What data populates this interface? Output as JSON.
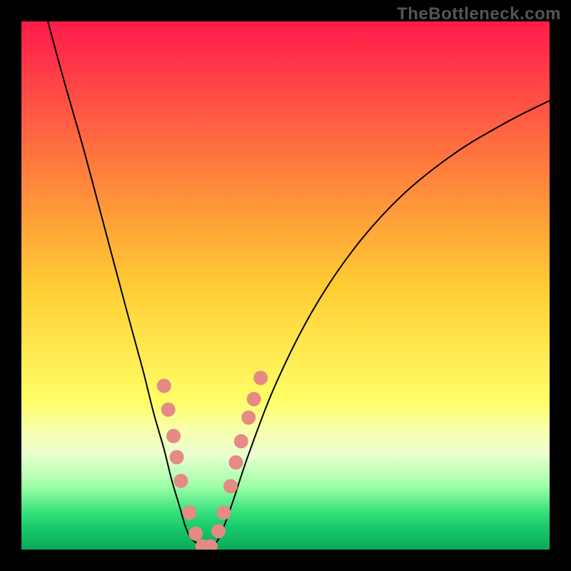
{
  "watermark": "TheBottleneck.com",
  "chart_data": {
    "type": "line",
    "title": "",
    "xlabel": "",
    "ylabel": "",
    "xlim": [
      0,
      100
    ],
    "ylim": [
      0,
      100
    ],
    "grid": false,
    "legend": false,
    "annotations": [],
    "background": {
      "type": "vertical-gradient",
      "stops": [
        {
          "offset": 0.0,
          "color": "#ff1a4b"
        },
        {
          "offset": 0.5,
          "color": "#ffcc33"
        },
        {
          "offset": 0.72,
          "color": "#ffff66"
        },
        {
          "offset": 0.78,
          "color": "#f6ffb3"
        },
        {
          "offset": 0.82,
          "color": "#eaffd0"
        },
        {
          "offset": 0.88,
          "color": "#9effa8"
        },
        {
          "offset": 0.93,
          "color": "#34e07a"
        },
        {
          "offset": 0.96,
          "color": "#17c86a"
        },
        {
          "offset": 1.0,
          "color": "#0aa85a"
        }
      ]
    },
    "series": [
      {
        "name": "curve",
        "color": "#000000",
        "width": 2,
        "x": [
          5,
          8,
          12,
          16,
          20,
          23,
          25,
          27,
          28.5,
          30,
          31,
          32,
          33.5,
          35,
          36,
          37,
          38,
          40,
          43,
          48,
          55,
          63,
          72,
          82,
          92,
          100
        ],
        "y": [
          100,
          89,
          75,
          60,
          45,
          34,
          26,
          19,
          13,
          8,
          4.5,
          2.3,
          1.0,
          0.4,
          0.4,
          1.5,
          3.5,
          9,
          18,
          31,
          45,
          57,
          67,
          75,
          81,
          85
        ]
      }
    ],
    "markers": [
      {
        "name": "dots",
        "color": "#e58a84",
        "radius": 10,
        "points": [
          {
            "x": 27.0,
            "y": 31.0
          },
          {
            "x": 27.8,
            "y": 26.5
          },
          {
            "x": 28.8,
            "y": 21.5
          },
          {
            "x": 29.4,
            "y": 17.5
          },
          {
            "x": 30.2,
            "y": 13.0
          },
          {
            "x": 31.8,
            "y": 7.0
          },
          {
            "x": 33.0,
            "y": 3.0
          },
          {
            "x": 34.3,
            "y": 0.6
          },
          {
            "x": 35.8,
            "y": 0.6
          },
          {
            "x": 37.3,
            "y": 3.5
          },
          {
            "x": 38.3,
            "y": 7.0
          },
          {
            "x": 39.6,
            "y": 12.0
          },
          {
            "x": 40.6,
            "y": 16.5
          },
          {
            "x": 41.6,
            "y": 20.5
          },
          {
            "x": 43.0,
            "y": 25.0
          },
          {
            "x": 44.0,
            "y": 28.5
          },
          {
            "x": 45.3,
            "y": 32.5
          }
        ]
      }
    ],
    "border": {
      "color": "#000000",
      "width": 30
    }
  }
}
